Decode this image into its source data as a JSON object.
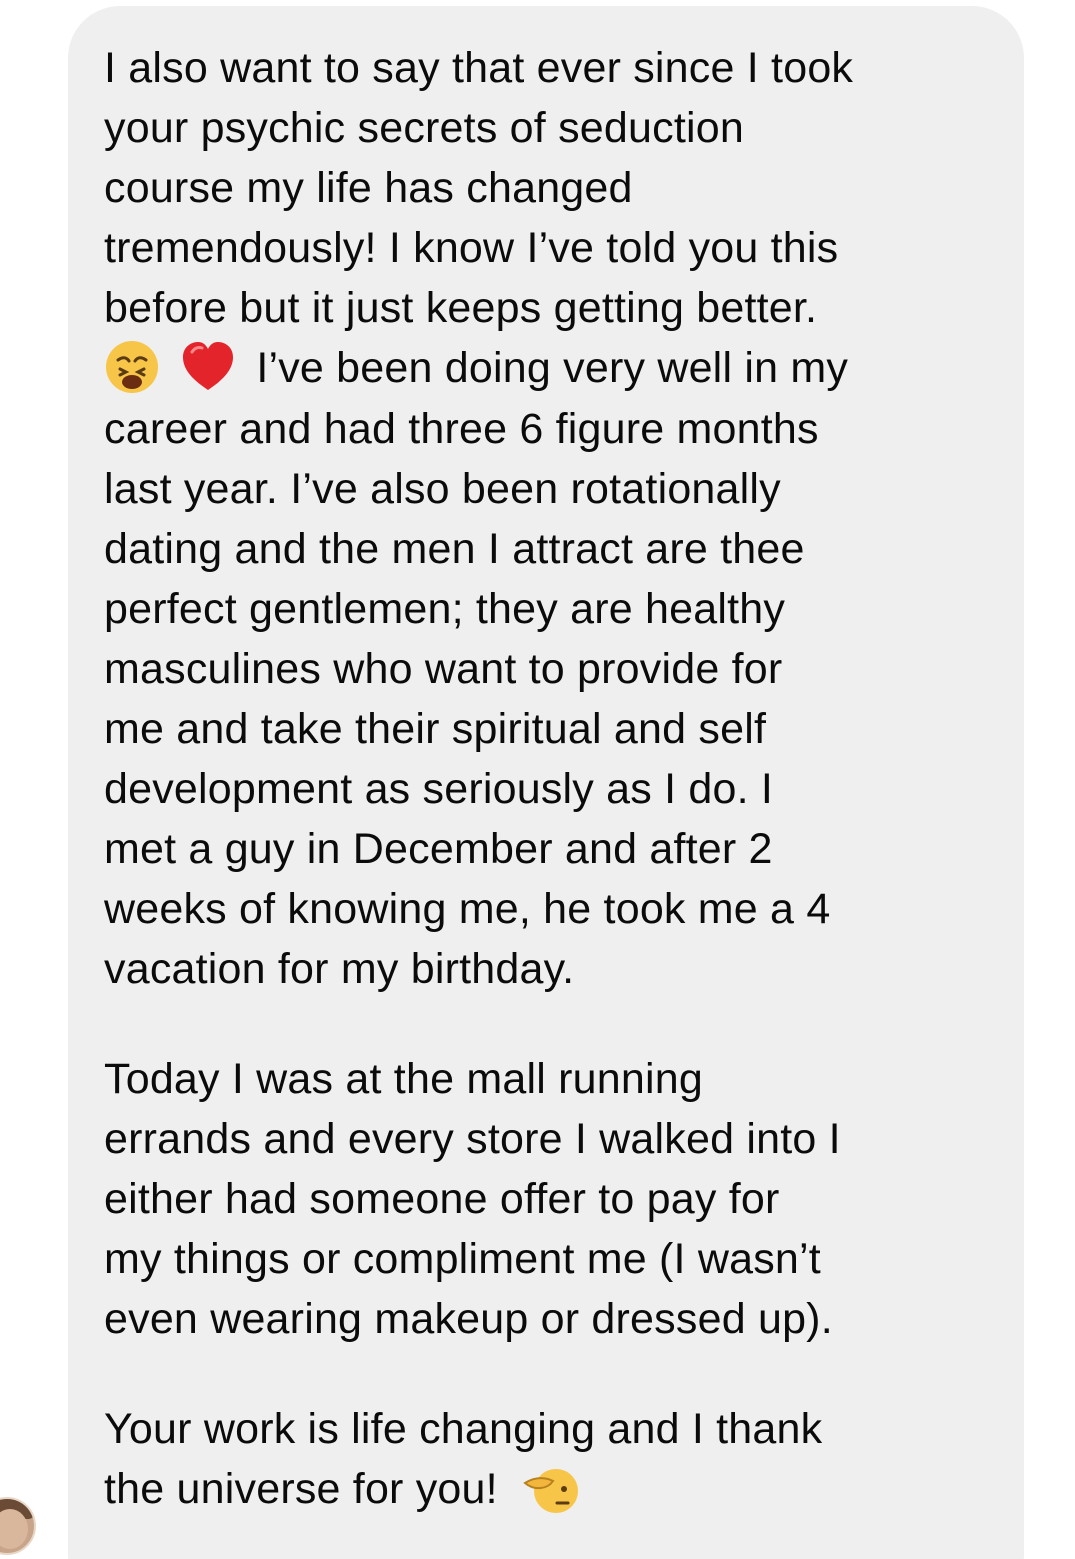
{
  "message": {
    "paragraph1": {
      "lines": [
        "I also want to say that ever since I took",
        "your psychic secrets of seduction",
        "course my life has changed",
        "tremendously! I know I’ve told you this",
        "before but it just keeps getting better.",
        "I’ve been doing very well in my",
        "career and had three 6 figure months",
        "last year. I’ve also been rotationally",
        "dating and the men I attract are thee",
        "perfect gentlemen; they are healthy",
        "masculines who want to provide for",
        "me and take their spiritual and self",
        "development as seriously as I do. I",
        "met a guy in December and after 2",
        "weeks of knowing me, he took me a 4",
        "vacation for my birthday."
      ]
    },
    "paragraph2": {
      "lines": [
        "Today I was at the mall running",
        "errands and every store I walked into I",
        "either had someone offer to pay for",
        "my things or compliment me (I wasn’t",
        "even wearing makeup or dressed up)."
      ]
    },
    "paragraph3": {
      "lines": [
        "Your work is life changing and I thank",
        "the universe for you!"
      ]
    },
    "emojis": {
      "weary": "weary-face-icon",
      "heart": "red-heart-icon",
      "salute": "saluting-face-icon"
    }
  },
  "colors": {
    "bubble": "#efefef",
    "text": "#0b0b0b",
    "emoji_yellow": "#f7c548",
    "heart_red": "#e3242b"
  }
}
